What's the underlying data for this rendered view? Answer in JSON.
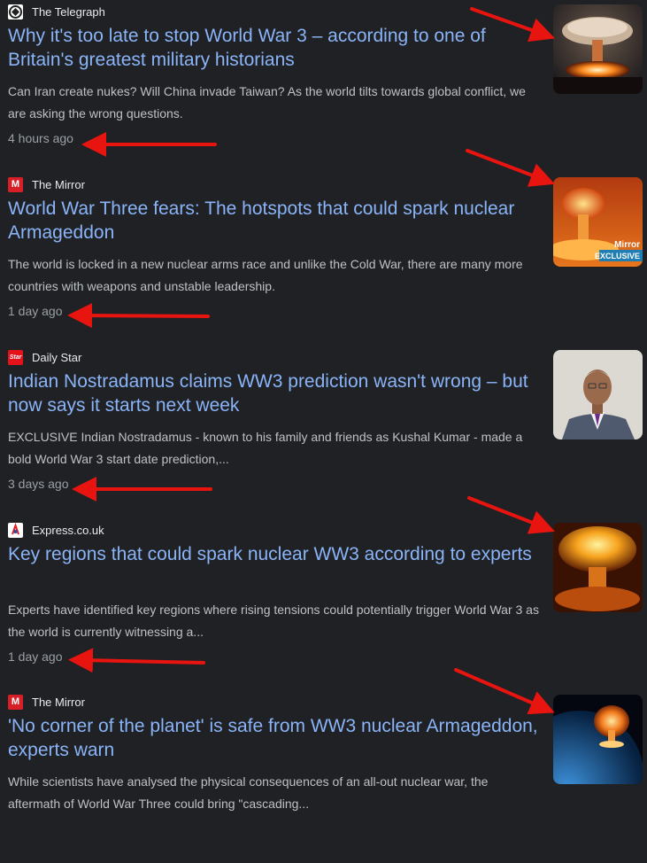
{
  "articles": [
    {
      "source": "The Telegraph",
      "logo_text": "",
      "title": "Why it's too late to stop World War 3 – according to one of Britain's greatest military historians",
      "snippet": "Can Iran create nukes? Will China invade Taiwan? As the world tilts towards global conflict, we are asking the wrong questions.",
      "time": "4 hours ago"
    },
    {
      "source": "The Mirror",
      "logo_text": "M",
      "title": "World War Three fears: The hotspots that could spark nuclear Armageddon",
      "snippet": "The world is locked in a new nuclear arms race and unlike the Cold War, there are many more countries with weapons and unstable leadership.",
      "time": "1 day ago",
      "thumb_text": [
        "Mirror",
        "EXCLUSIVE"
      ]
    },
    {
      "source": "Daily Star",
      "logo_text": "Star",
      "title": "Indian Nostradamus claims WW3 prediction wasn't wrong – but now says it starts next week",
      "snippet": "EXCLUSIVE Indian Nostradamus - known to his family and friends as Kushal Kumar - made a bold World War 3 start date prediction,...",
      "time": "3 days ago"
    },
    {
      "source": "Express.co.uk",
      "logo_text": "",
      "title": "Key regions that could spark nuclear WW3 according to experts",
      "snippet": "Experts have identified key regions where rising tensions could potentially trigger World War 3 as the world is currently witnessing a...",
      "time": "1 day ago"
    },
    {
      "source": "The Mirror",
      "logo_text": "M",
      "title": "'No corner of the planet' is safe from WW3 nuclear Armageddon, experts warn",
      "snippet": "While scientists have analysed the physical consequences of an all-out nuclear war, the aftermath of World War Three could bring \"cascading...",
      "time": ""
    }
  ],
  "colors": {
    "background": "#202124",
    "title": "#8ab4f8",
    "snippet": "#bdc1c6",
    "time": "#9aa0a6",
    "arrow": "#e8140f"
  }
}
